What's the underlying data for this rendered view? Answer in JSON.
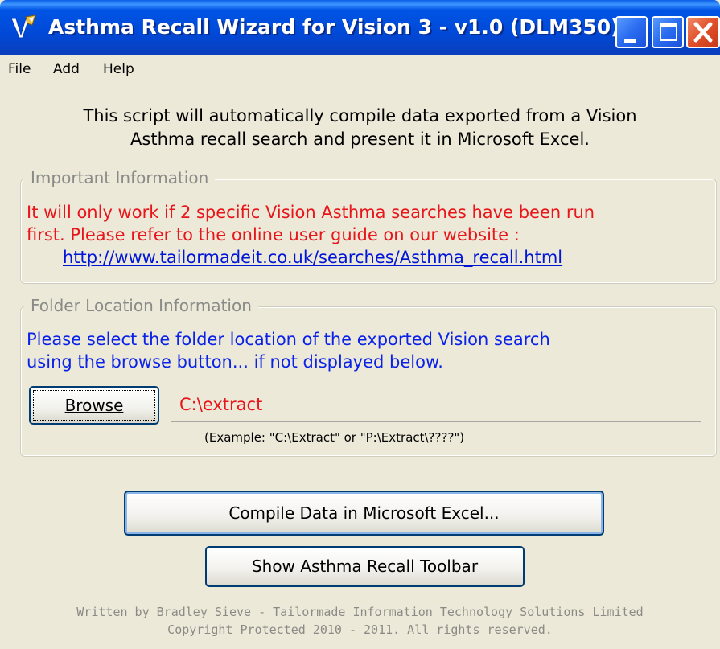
{
  "window": {
    "title": "Asthma Recall Wizard for Vision 3 - v1.0 (DLM350)",
    "icons": {
      "app": "pen-tool-icon",
      "minimize": "minimize-icon",
      "maximize": "maximize-icon",
      "close": "close-icon"
    }
  },
  "menu": {
    "items": [
      "File",
      "Add",
      "Help"
    ]
  },
  "intro": {
    "line1": "This script will automatically compile data exported from a Vision",
    "line2": "Asthma recall search and present it in Microsoft Excel."
  },
  "important": {
    "legend": "Important Information",
    "line1": "It will only work if 2 specific Vision Asthma searches have been run",
    "line2": "first. Please refer to the online user guide on our website :",
    "link": "http://www.tailormadeit.co.uk/searches/Asthma_recall.html"
  },
  "folder": {
    "legend": "Folder Location Information",
    "line1": "Please select the folder location of the exported Vision search",
    "line2": "using the browse button... if not displayed below.",
    "browse_label": "Browse",
    "path_value": "C:\\extract",
    "example": "(Example: \"C:\\Extract\" or \"P:\\Extract\\????\")"
  },
  "actions": {
    "compile_label": "Compile Data in Microsoft Excel...",
    "toolbar_label": "Show Asthma Recall Toolbar"
  },
  "footer": {
    "line1": "Written by Bradley Sieve - Tailormade Information Technology Solutions Limited",
    "line2": "Copyright Protected 2010 - 2011. All rights reserved."
  },
  "colors": {
    "titlebar": "#0055e5",
    "window_bg": "#ece9d8",
    "warning_text": "#e8151a",
    "info_text": "#0a22e8",
    "link": "#0015d8"
  }
}
